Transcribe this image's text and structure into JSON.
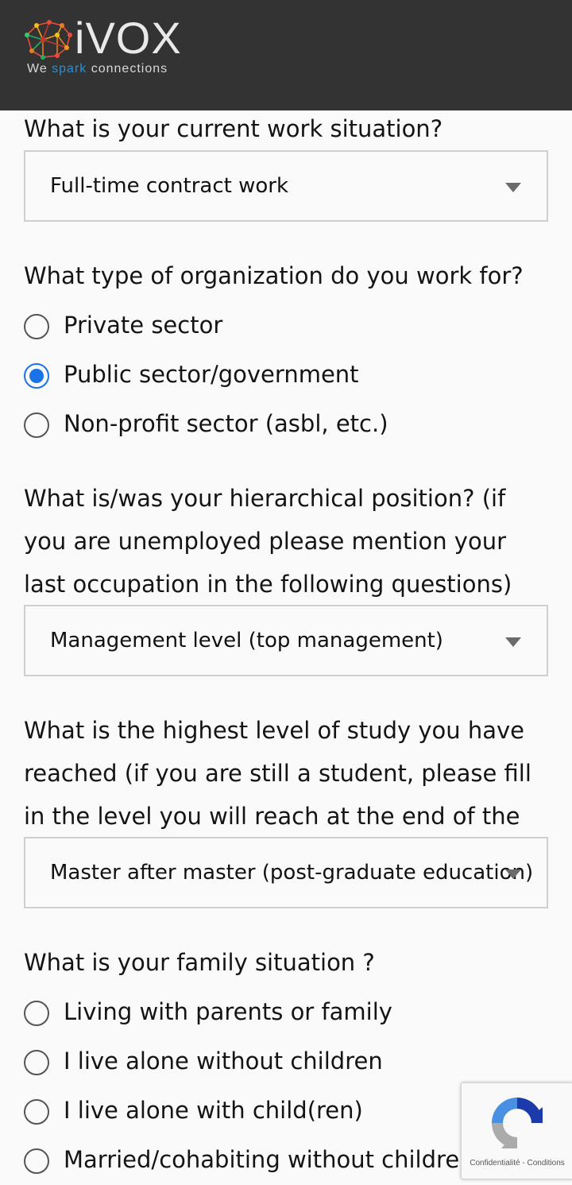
{
  "header": {
    "brand": "iVOX",
    "tagline_prefix": "We ",
    "tagline_accent": "spark",
    "tagline_suffix": " connections",
    "accent_color": "#2a8fd0",
    "background_color": "#333333"
  },
  "q_work_situation": {
    "question": "What is your current work situation?",
    "selected": "Full-time contract work"
  },
  "q_organization": {
    "question": "What type of organization do you work for?",
    "options": [
      {
        "label": "Private sector",
        "checked": false
      },
      {
        "label": "Public sector/government",
        "checked": true
      },
      {
        "label": "Non-profit sector (asbl, etc.)",
        "checked": false
      }
    ]
  },
  "q_hierarchy": {
    "question": "What is/was your hierarchical position? (if you are unemployed please mention your last occupation in the following questions)",
    "selected": "Management level (top management)"
  },
  "q_study": {
    "question": "What is the highest level of study you have reached (if you are still a student, please fill in the level you will reach at the end of the year)?",
    "selected": "Master after master (post-graduate education)"
  },
  "q_family": {
    "question": "What is your family situation ?",
    "options": [
      {
        "label": "Living with parents or family",
        "checked": false
      },
      {
        "label": "I live alone without children",
        "checked": false
      },
      {
        "label": "I live alone with child(ren)",
        "checked": false
      },
      {
        "label": "Married/cohabiting without children",
        "checked": false
      }
    ]
  },
  "recaptcha": {
    "privacy": "Confidentialité",
    "separator": " - ",
    "terms": "Conditions"
  }
}
